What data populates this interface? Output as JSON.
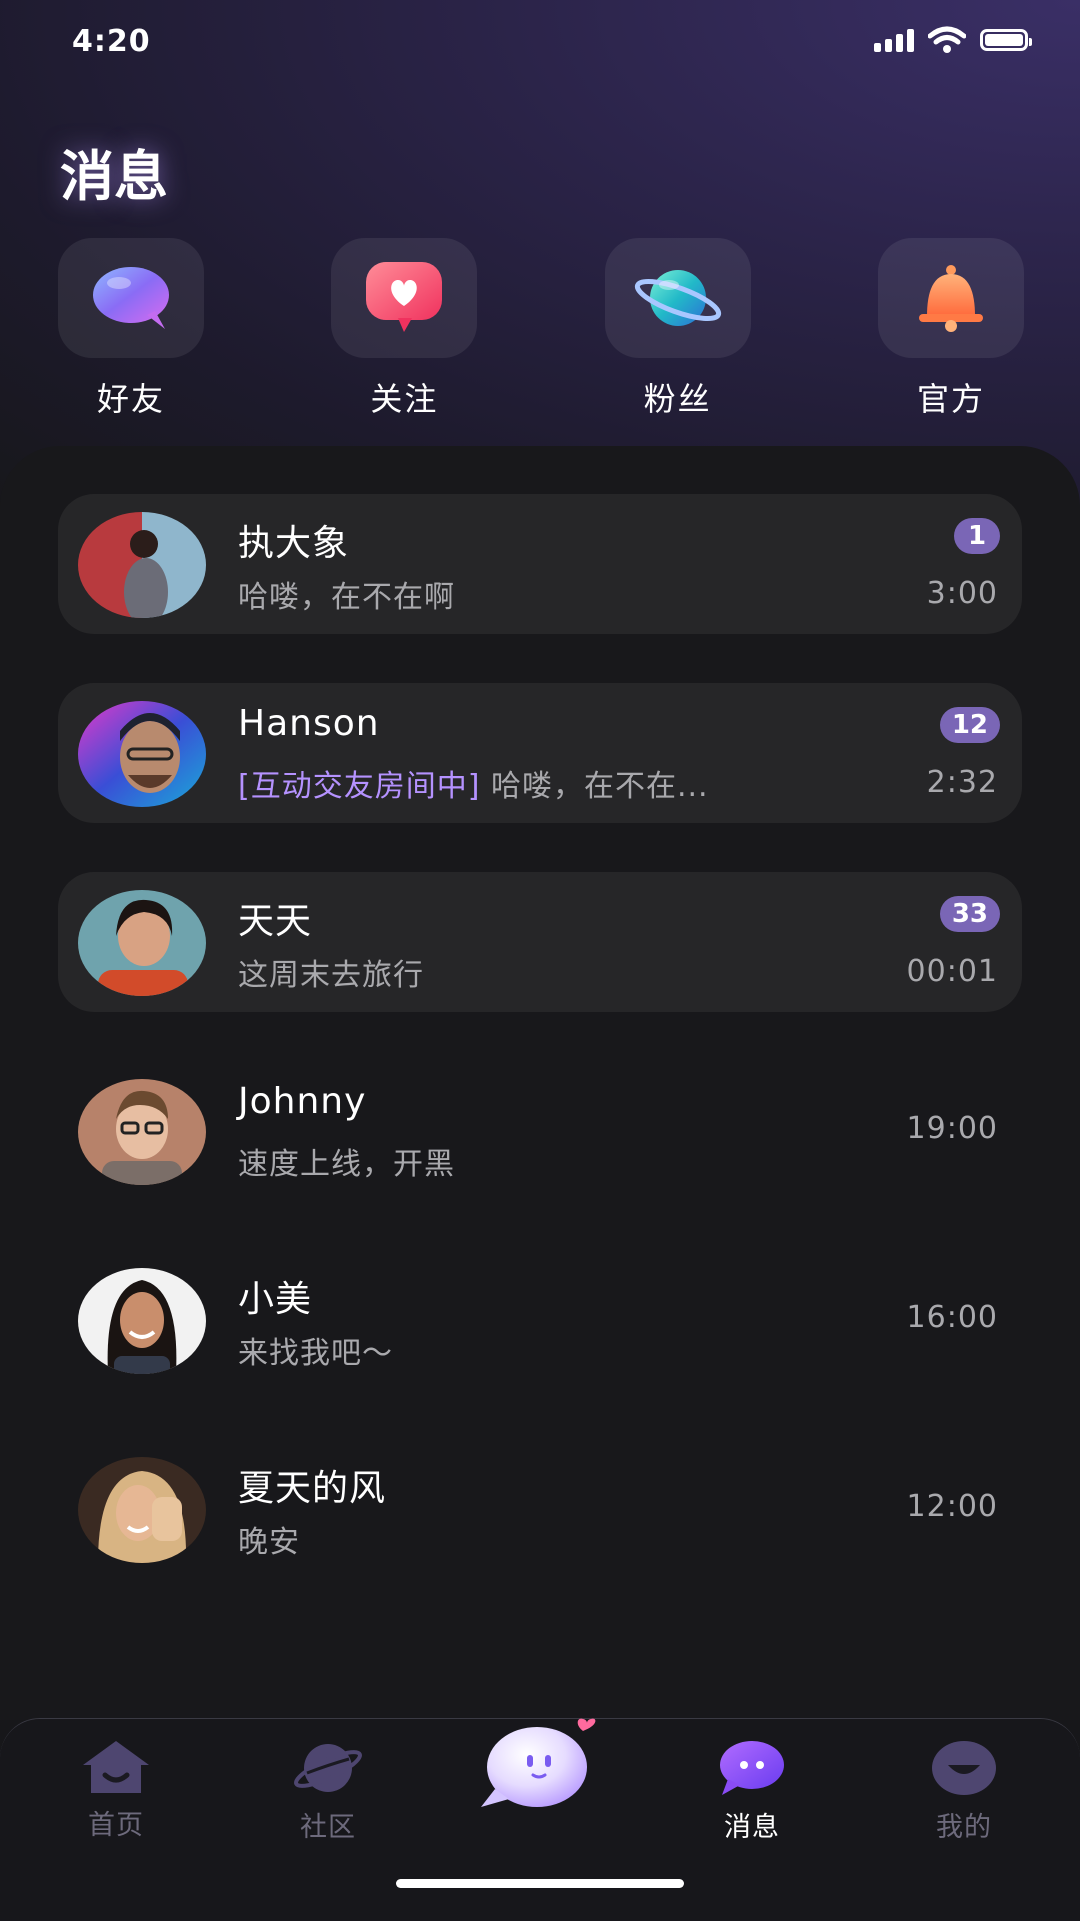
{
  "status_bar": {
    "time": "4:20"
  },
  "header": {
    "title": "消息"
  },
  "categories": [
    {
      "label": "好友",
      "icon": "chat-bubble-icon"
    },
    {
      "label": "关注",
      "icon": "heart-bubble-icon"
    },
    {
      "label": "粉丝",
      "icon": "planet-icon"
    },
    {
      "label": "官方",
      "icon": "bell-icon"
    }
  ],
  "chats": [
    {
      "name": "执大象",
      "message": "哈喽，在不在啊",
      "time": "3:00",
      "unread": "1"
    },
    {
      "name": "Hanson",
      "tag": "[互动交友房间中]",
      "message": " 哈喽，在不在...",
      "time": "2:32",
      "unread": "12"
    },
    {
      "name": "天天",
      "message": "这周末去旅行",
      "time": "00:01",
      "unread": "33"
    },
    {
      "name": "Johnny",
      "message": "速度上线，开黑",
      "time": "19:00"
    },
    {
      "name": "小美",
      "message": "来找我吧～",
      "time": "16:00"
    },
    {
      "name": "夏天的风",
      "message": "晚安",
      "time": "12:00"
    }
  ],
  "tabs": [
    {
      "label": "首页",
      "icon": "home-icon"
    },
    {
      "label": "社区",
      "icon": "planet-icon"
    },
    {
      "label": "",
      "icon": "mascot-icon"
    },
    {
      "label": "消息",
      "icon": "message-icon",
      "active": true
    },
    {
      "label": "我的",
      "icon": "profile-icon"
    }
  ],
  "colors": {
    "accent": "#7a66b6",
    "tag": "#b592ff",
    "background": "#17171a"
  }
}
